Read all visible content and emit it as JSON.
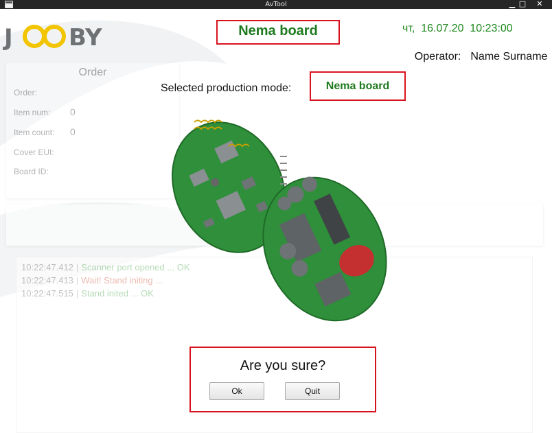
{
  "window": {
    "title": "AvTool",
    "controls": {
      "minimize": "▁",
      "maximize": "□",
      "close": "✕"
    },
    "icon": "app-window-icon"
  },
  "logo": {
    "text": "J  BY",
    "icon": "jooby-logo-icon"
  },
  "header": {
    "title": "Nema board",
    "datetime": "чт,  16.07.20  10:23:00",
    "operator_label": "Operator:",
    "operator_name": "Name Surname"
  },
  "order": {
    "title": "Order",
    "fields": [
      {
        "label": "Order:",
        "value": ""
      },
      {
        "label": "Item num:",
        "value": "0"
      },
      {
        "label": "Item count:",
        "value": "0"
      },
      {
        "label": "Cover EUI:",
        "value": ""
      },
      {
        "label": "Board ID:",
        "value": ""
      }
    ]
  },
  "mode": {
    "label": "Selected production mode:",
    "value": "Nema board"
  },
  "log": [
    {
      "time": "10:22:47.412",
      "message": "Scanner port opened ... OK",
      "status": "ok"
    },
    {
      "time": "10:22:47.413",
      "message": "Wait! Stand initing ...",
      "status": "warn"
    },
    {
      "time": "10:22:47.515",
      "message": "Stand inited ... OK",
      "status": "ok"
    }
  ],
  "dialog": {
    "message": "Are you sure?",
    "ok_label": "Ok",
    "quit_label": "Quit"
  },
  "colors": {
    "accent_red": "#d9121f",
    "title_green": "#1e7a1e",
    "pcb_green": "#2f8f3a",
    "logo_yellow": "#f2c500"
  }
}
